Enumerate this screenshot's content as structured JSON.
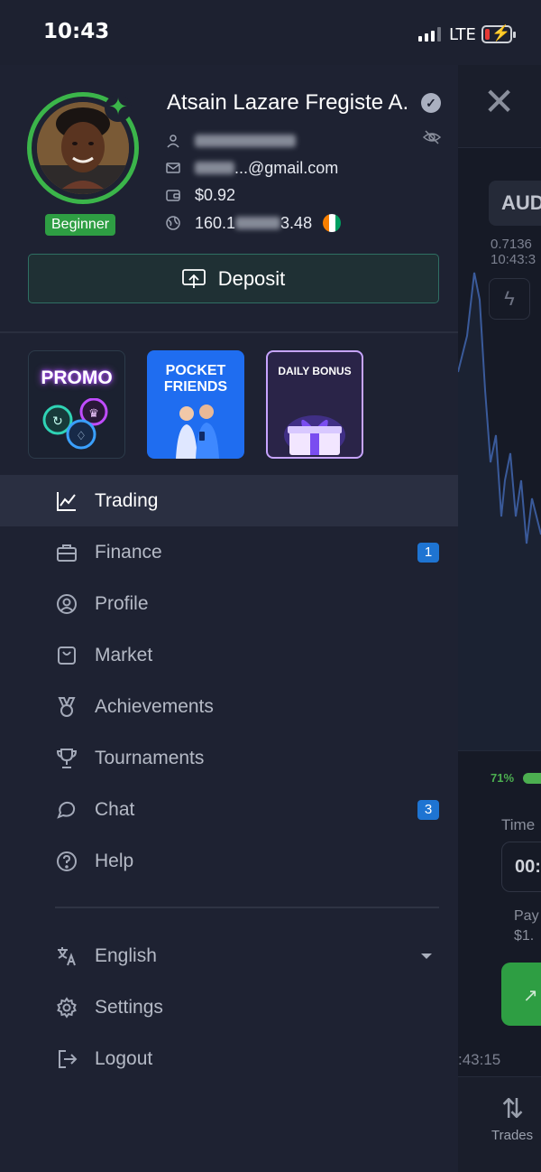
{
  "status_bar": {
    "time": "10:43",
    "network": "LTE"
  },
  "user": {
    "name": "Atsain Lazare Fregiste A.",
    "level": "Beginner",
    "email_suffix": "...@gmail.com",
    "balance": "$0.92",
    "ip_prefix": "160.1",
    "ip_suffix": "3.48"
  },
  "deposit_label": "Deposit",
  "promos": {
    "promo": "PROMO",
    "pocket_friends_line1": "POCKET",
    "pocket_friends_line2": "FRIENDS",
    "daily_bonus": "DAILY BONUS"
  },
  "menu": {
    "trading": "Trading",
    "finance": "Finance",
    "finance_badge": "1",
    "profile": "Profile",
    "market": "Market",
    "achievements": "Achievements",
    "tournaments": "Tournaments",
    "chat": "Chat",
    "chat_badge": "3",
    "help": "Help"
  },
  "bottom_menu": {
    "language": "English",
    "settings": "Settings",
    "logout": "Logout"
  },
  "background": {
    "asset": "AUD",
    "price": "0.7136",
    "price_time": "10:43:3",
    "payout_pct": "71%",
    "time_label": "Time",
    "time_value": "00:",
    "payout_label": "Pay",
    "payout_value": "$1.",
    "clock": ":43:15",
    "trades": "Trades"
  },
  "colors": {
    "accent_green": "#3bb54a",
    "badge_blue": "#1e74d2",
    "drawer_bg": "#1e2232"
  }
}
